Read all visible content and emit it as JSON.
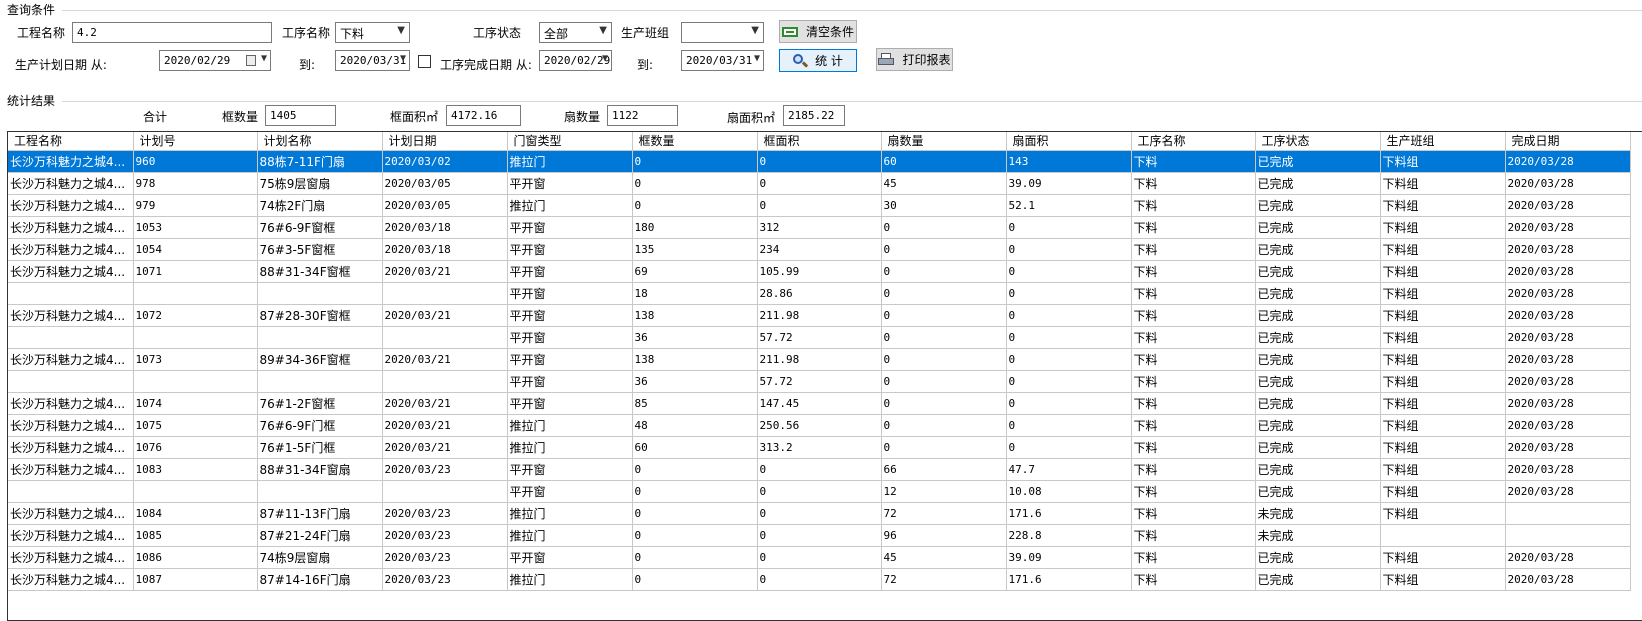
{
  "query": {
    "group_title": "查询条件",
    "project_label": "工程名称",
    "project_value": "4.2",
    "process_label": "工序名称",
    "process_value": "下料",
    "status_label": "工序状态",
    "status_value": "全部",
    "team_label": "生产班组",
    "team_value": "",
    "clear_button": "清空条件",
    "plan_date_label": "生产计划日期 从:",
    "plan_from": "2020/02/29",
    "to_label": "到:",
    "plan_to": "2020/03/31",
    "done_date_label": "工序完成日期 从:",
    "done_from": "2020/02/29",
    "done_to": "2020/03/31",
    "stat_button": "统 计",
    "print_button": "打印报表"
  },
  "stats": {
    "group_title": "统计结果",
    "total_label": "合计",
    "frame_count_label": "框数量",
    "frame_count": "1405",
    "frame_area_label": "框面积㎡",
    "frame_area": "4172.16",
    "sash_count_label": "扇数量",
    "sash_count": "1122",
    "sash_area_label": "扇面积㎡",
    "sash_area": "2185.22"
  },
  "table": {
    "columns": [
      "工程名称",
      "计划号",
      "计划名称",
      "计划日期",
      "门窗类型",
      "框数量",
      "框面积",
      "扇数量",
      "扇面积",
      "工序名称",
      "工序状态",
      "生产班组",
      "完成日期"
    ],
    "rows": [
      [
        "长沙万科魅力之城4...",
        "960",
        "88栋7-11F门扇",
        "2020/03/02",
        "推拉门",
        "0",
        "0",
        "60",
        "143",
        "下料",
        "已完成",
        "下料组",
        "2020/03/28"
      ],
      [
        "长沙万科魅力之城4...",
        "978",
        "75栋9层窗扇",
        "2020/03/05",
        "平开窗",
        "0",
        "0",
        "45",
        "39.09",
        "下料",
        "已完成",
        "下料组",
        "2020/03/28"
      ],
      [
        "长沙万科魅力之城4...",
        "979",
        "74栋2F门扇",
        "2020/03/05",
        "推拉门",
        "0",
        "0",
        "30",
        "52.1",
        "下料",
        "已完成",
        "下料组",
        "2020/03/28"
      ],
      [
        "长沙万科魅力之城4...",
        "1053",
        "76#6-9F窗框",
        "2020/03/18",
        "平开窗",
        "180",
        "312",
        "0",
        "0",
        "下料",
        "已完成",
        "下料组",
        "2020/03/28"
      ],
      [
        "长沙万科魅力之城4...",
        "1054",
        "76#3-5F窗框",
        "2020/03/18",
        "平开窗",
        "135",
        "234",
        "0",
        "0",
        "下料",
        "已完成",
        "下料组",
        "2020/03/28"
      ],
      [
        "长沙万科魅力之城4...",
        "1071",
        "88#31-34F窗框",
        "2020/03/21",
        "平开窗",
        "69",
        "105.99",
        "0",
        "0",
        "下料",
        "已完成",
        "下料组",
        "2020/03/28"
      ],
      [
        "",
        "",
        "",
        "",
        "平开窗",
        "18",
        "28.86",
        "0",
        "0",
        "下料",
        "已完成",
        "下料组",
        "2020/03/28"
      ],
      [
        "长沙万科魅力之城4...",
        "1072",
        "87#28-30F窗框",
        "2020/03/21",
        "平开窗",
        "138",
        "211.98",
        "0",
        "0",
        "下料",
        "已完成",
        "下料组",
        "2020/03/28"
      ],
      [
        "",
        "",
        "",
        "",
        "平开窗",
        "36",
        "57.72",
        "0",
        "0",
        "下料",
        "已完成",
        "下料组",
        "2020/03/28"
      ],
      [
        "长沙万科魅力之城4...",
        "1073",
        "89#34-36F窗框",
        "2020/03/21",
        "平开窗",
        "138",
        "211.98",
        "0",
        "0",
        "下料",
        "已完成",
        "下料组",
        "2020/03/28"
      ],
      [
        "",
        "",
        "",
        "",
        "平开窗",
        "36",
        "57.72",
        "0",
        "0",
        "下料",
        "已完成",
        "下料组",
        "2020/03/28"
      ],
      [
        "长沙万科魅力之城4...",
        "1074",
        "76#1-2F窗框",
        "2020/03/21",
        "平开窗",
        "85",
        "147.45",
        "0",
        "0",
        "下料",
        "已完成",
        "下料组",
        "2020/03/28"
      ],
      [
        "长沙万科魅力之城4...",
        "1075",
        "76#6-9F门框",
        "2020/03/21",
        "推拉门",
        "48",
        "250.56",
        "0",
        "0",
        "下料",
        "已完成",
        "下料组",
        "2020/03/28"
      ],
      [
        "长沙万科魅力之城4...",
        "1076",
        "76#1-5F门框",
        "2020/03/21",
        "推拉门",
        "60",
        "313.2",
        "0",
        "0",
        "下料",
        "已完成",
        "下料组",
        "2020/03/28"
      ],
      [
        "长沙万科魅力之城4...",
        "1083",
        "88#31-34F窗扇",
        "2020/03/23",
        "平开窗",
        "0",
        "0",
        "66",
        "47.7",
        "下料",
        "已完成",
        "下料组",
        "2020/03/28"
      ],
      [
        "",
        "",
        "",
        "",
        "平开窗",
        "0",
        "0",
        "12",
        "10.08",
        "下料",
        "已完成",
        "下料组",
        "2020/03/28"
      ],
      [
        "长沙万科魅力之城4...",
        "1084",
        "87#11-13F门扇",
        "2020/03/23",
        "推拉门",
        "0",
        "0",
        "72",
        "171.6",
        "下料",
        "未完成",
        "下料组",
        ""
      ],
      [
        "长沙万科魅力之城4...",
        "1085",
        "87#21-24F门扇",
        "2020/03/23",
        "推拉门",
        "0",
        "0",
        "96",
        "228.8",
        "下料",
        "未完成",
        "",
        ""
      ],
      [
        "长沙万科魅力之城4...",
        "1086",
        "74栋9层窗扇",
        "2020/03/23",
        "平开窗",
        "0",
        "0",
        "45",
        "39.09",
        "下料",
        "已完成",
        "下料组",
        "2020/03/28"
      ],
      [
        "长沙万科魅力之城4...",
        "1087",
        "87#14-16F门扇",
        "2020/03/23",
        "推拉门",
        "0",
        "0",
        "72",
        "171.6",
        "下料",
        "已完成",
        "下料组",
        "2020/03/28"
      ]
    ],
    "selected_row": 0
  },
  "colors": {
    "selection": "#0078d7",
    "grid_line": "#c8c8c8"
  }
}
